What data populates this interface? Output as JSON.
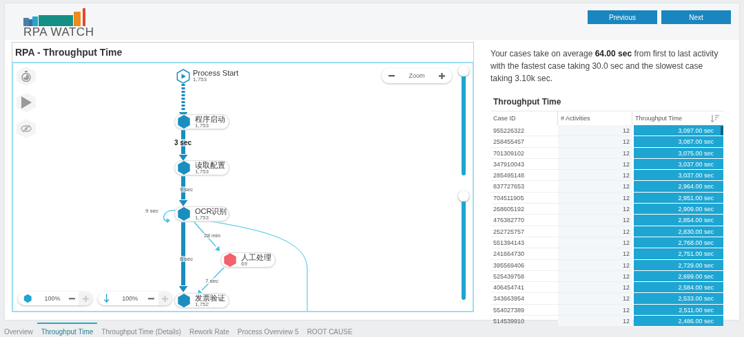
{
  "header": {
    "logo_text": "RPA WATCH",
    "buttons": [
      "Previous",
      "Next"
    ]
  },
  "panel": {
    "title": "RPA - Throughput Time",
    "zoom_label": "Zoom",
    "nodes": [
      {
        "name": "Process Start",
        "count": "1,753",
        "kind": "start",
        "color": "#1a8fbf"
      },
      {
        "name": "程序启动",
        "count": "1,753",
        "kind": "activity",
        "color": "#1a8fbf"
      },
      {
        "name": "读取配置",
        "count": "1,753",
        "kind": "activity",
        "color": "#1a8fbf"
      },
      {
        "name": "OCR识别",
        "count": "1,753",
        "kind": "activity",
        "color": "#1a8fbf"
      },
      {
        "name": "人工处理",
        "count": "69",
        "kind": "activity",
        "color": "#f4606c"
      },
      {
        "name": "发票验证",
        "count": "1,752",
        "kind": "activity",
        "color": "#1a8fbf"
      }
    ],
    "edges": [
      {
        "kind": "dashed"
      },
      {
        "kind": "thick",
        "label": "3 sec",
        "bold": true
      },
      {
        "kind": "thick",
        "label": "9 sec",
        "bold": false
      },
      {
        "kind": "loop",
        "label": "9 sec",
        "bold": false
      },
      {
        "kind": "thin",
        "label": "28 min",
        "bold": false
      },
      {
        "kind": "thick",
        "label": "6 sec",
        "bold": false
      },
      {
        "kind": "thin",
        "label": "7 sec",
        "bold": false
      },
      {
        "kind": "curve"
      }
    ],
    "filters": [
      {
        "kind": "activities",
        "value": "100%"
      },
      {
        "kind": "paths",
        "value": "100%"
      }
    ],
    "sliders": [
      {
        "level": 1
      },
      {
        "level": 1
      }
    ]
  },
  "summary": "Your cases take on average **64.00 sec** from first to last activity with the fastest case taking 30.0 sec and the slowest case taking 3.10k sec.",
  "table": {
    "title": "Throughput Time",
    "columns": [
      "Case ID",
      "# Activities",
      "Throughput Time"
    ],
    "rows": [
      [
        "955226322",
        "12",
        "3,097.00 sec"
      ],
      [
        "258455457",
        "12",
        "3,087.00 sec"
      ],
      [
        "701309102",
        "12",
        "3,075.00 sec"
      ],
      [
        "347910043",
        "12",
        "3,037.00 sec"
      ],
      [
        "285495148",
        "12",
        "3,037.00 sec"
      ],
      [
        "837727653",
        "12",
        "2,964.00 sec"
      ],
      [
        "704511905",
        "12",
        "2,951.00 sec"
      ],
      [
        "268605192",
        "12",
        "2,909.00 sec"
      ],
      [
        "476382770",
        "12",
        "2,854.00 sec"
      ],
      [
        "252725757",
        "12",
        "2,830.00 sec"
      ],
      [
        "551394143",
        "12",
        "2,768.00 sec"
      ],
      [
        "241664730",
        "12",
        "2,751.00 sec"
      ],
      [
        "395569406",
        "12",
        "2,729.00 sec"
      ],
      [
        "525439758",
        "12",
        "2,699.00 sec"
      ],
      [
        "406454741",
        "12",
        "2,584.00 sec"
      ],
      [
        "343663954",
        "12",
        "2,533.00 sec"
      ],
      [
        "554027389",
        "12",
        "2,511.00 sec"
      ],
      [
        "514539910",
        "12",
        "2,486.00 sec"
      ]
    ]
  },
  "tabs": [
    {
      "label": "Overview",
      "selected": false
    },
    {
      "label": "Throughput Time",
      "selected": true
    },
    {
      "label": "Throughput Time (Details)",
      "selected": false
    },
    {
      "label": "Rework Rate",
      "selected": false
    },
    {
      "label": "Process Overview 5",
      "selected": false
    },
    {
      "label": "ROOT CAUSE",
      "selected": false
    }
  ]
}
